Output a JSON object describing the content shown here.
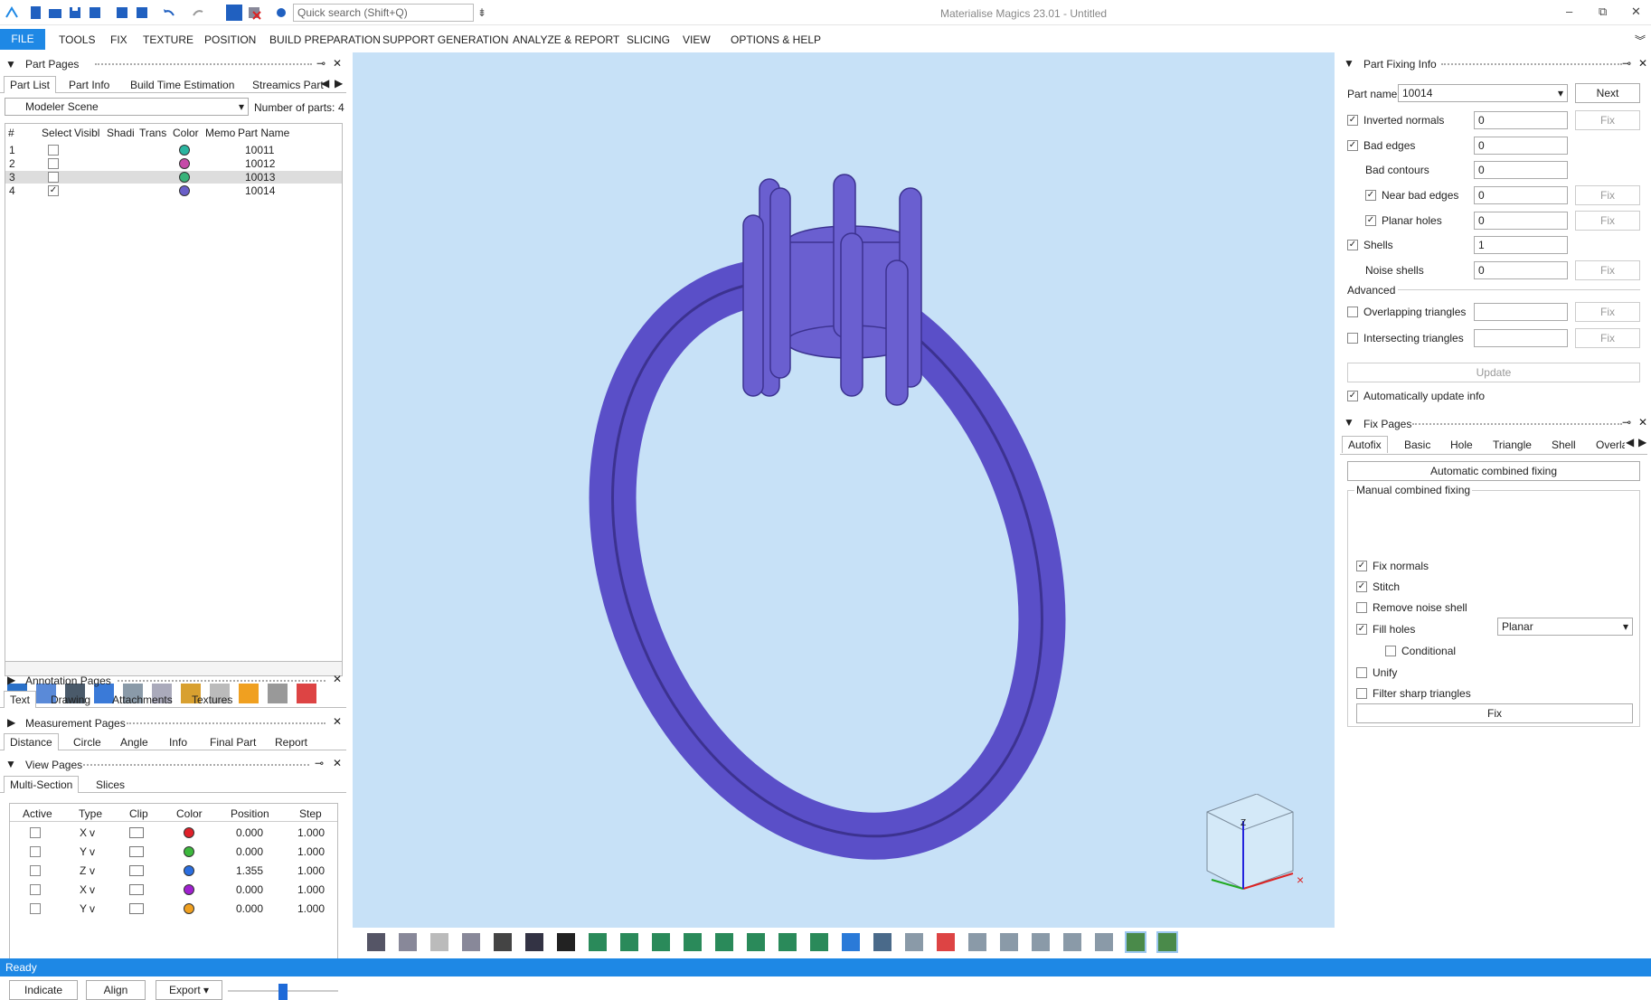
{
  "app": {
    "title": "Materialise Magics 23.01 - Untitled",
    "quick_search_placeholder": "Quick search (Shift+Q)"
  },
  "menu": [
    "FILE",
    "TOOLS",
    "FIX",
    "TEXTURE",
    "POSITION",
    "BUILD PREPARATION",
    "SUPPORT GENERATION",
    "ANALYZE & REPORT",
    "SLICING",
    "VIEW",
    "OPTIONS & HELP"
  ],
  "part_pages": {
    "title": "Part Pages",
    "tabs": [
      "Part List",
      "Part Info",
      "Build Time Estimation",
      "Streamics Part"
    ],
    "scene": "Modeler Scene",
    "num_parts_label": "Number of parts:",
    "num_parts": "4",
    "columns": [
      "#",
      "Select",
      "Visibl",
      "Shadi",
      "Trans",
      "Color",
      "Memo",
      "Part Name"
    ],
    "rows": [
      {
        "n": "1",
        "name": "10011",
        "checked": "",
        "color": "#2bb5a0"
      },
      {
        "n": "2",
        "name": "10012",
        "checked": "",
        "color": "#c64aa8"
      },
      {
        "n": "3",
        "name": "10013",
        "checked": "",
        "color": "#39b37a"
      },
      {
        "n": "4",
        "name": "10014",
        "checked": "✓",
        "color": "#6a5fc8"
      }
    ]
  },
  "annotation": {
    "title": "Annotation Pages",
    "tabs": [
      "Text",
      "Drawing",
      "Attachments",
      "Textures"
    ]
  },
  "measurement": {
    "title": "Measurement Pages",
    "tabs": [
      "Distance",
      "Circle",
      "Angle",
      "Info",
      "Final Part",
      "Report"
    ]
  },
  "view_pages": {
    "title": "View Pages",
    "tabs": [
      "Multi-Section",
      "Slices"
    ],
    "columns": [
      "Active",
      "Type",
      "Clip",
      "Color",
      "Position",
      "Step"
    ],
    "rows": [
      {
        "type": "X",
        "color": "#e0202a",
        "pos": "0.000",
        "step": "1.000"
      },
      {
        "type": "Y",
        "color": "#3cb83c",
        "pos": "0.000",
        "step": "1.000"
      },
      {
        "type": "Z",
        "color": "#2a6ee0",
        "pos": "1.355",
        "step": "1.000"
      },
      {
        "type": "X",
        "color": "#a020d0",
        "pos": "0.000",
        "step": "1.000"
      },
      {
        "type": "Y",
        "color": "#f0a020",
        "pos": "0.000",
        "step": "1.000"
      }
    ],
    "buttons": [
      "Indicate",
      "Align",
      "Export"
    ]
  },
  "fixing_info": {
    "title": "Part Fixing Info",
    "part_name_label": "Part name",
    "part_name": "10014",
    "next": "Next",
    "rows": [
      {
        "label": "Inverted normals",
        "val": "0",
        "chk": "✓",
        "fix": true
      },
      {
        "label": "Bad edges",
        "val": "0",
        "chk": "✓",
        "fix": false
      },
      {
        "label": "Bad contours",
        "val": "0",
        "chk": null,
        "fix": false
      },
      {
        "label": "Near bad edges",
        "val": "0",
        "chk": "✓",
        "fix": true
      },
      {
        "label": "Planar holes",
        "val": "0",
        "chk": "✓",
        "fix": true
      },
      {
        "label": "Shells",
        "val": "1",
        "chk": "✓",
        "fix": false
      },
      {
        "label": "Noise shells",
        "val": "0",
        "chk": null,
        "fix": true
      }
    ],
    "advanced": "Advanced",
    "overlapping": "Overlapping triangles",
    "intersecting": "Intersecting triangles",
    "fix": "Fix",
    "update": "Update",
    "auto_update": "Automatically update info"
  },
  "fix_pages": {
    "title": "Fix Pages",
    "tabs": [
      "Autofix",
      "Basic",
      "Hole",
      "Triangle",
      "Shell",
      "Overla"
    ],
    "auto_combined": "Automatic combined fixing",
    "manual_title": "Manual combined fixing",
    "options": [
      {
        "label": "Fix normals",
        "chk": "✓"
      },
      {
        "label": "Stitch",
        "chk": "✓"
      },
      {
        "label": "Remove noise shell",
        "chk": ""
      },
      {
        "label": "Fill holes",
        "chk": "✓"
      },
      {
        "label": "Conditional",
        "chk": ""
      },
      {
        "label": "Unify",
        "chk": ""
      },
      {
        "label": "Filter sharp triangles",
        "chk": ""
      }
    ],
    "fill_mode": "Planar",
    "fix": "Fix"
  },
  "status": "Ready",
  "colors": {
    "accent": "#1e88e5",
    "viewport": "#c7e1f7",
    "ring": "#6a5fc8"
  }
}
